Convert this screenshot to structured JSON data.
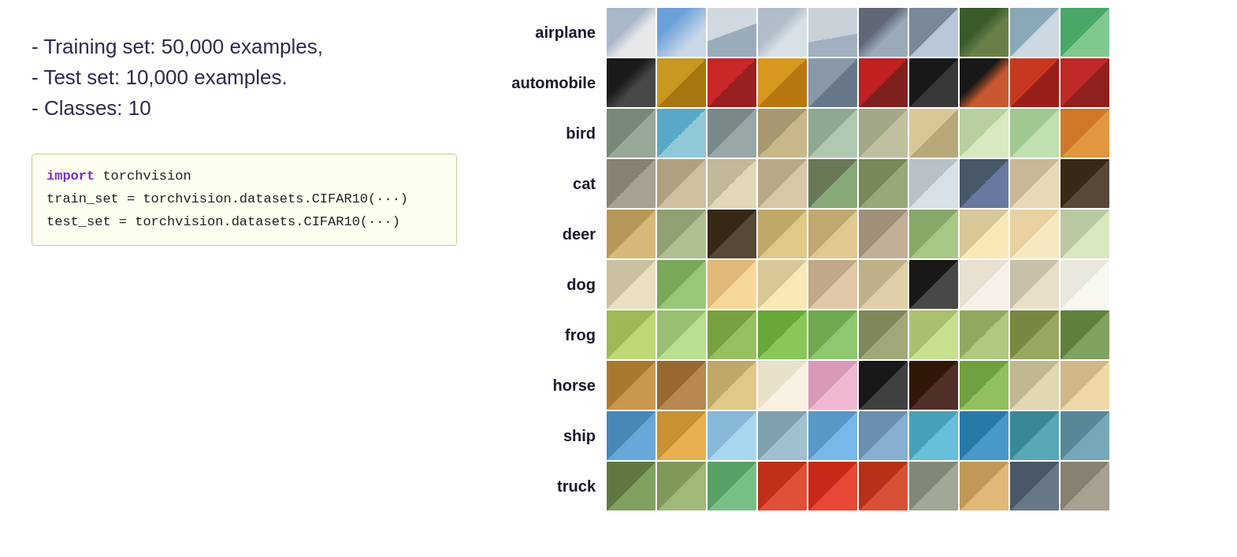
{
  "left": {
    "stats": [
      "- Training set: 50,000 examples,",
      "- Test set: 10,000 examples.",
      "- Classes: 10"
    ],
    "code": {
      "line1_keyword": "import",
      "line1_rest": " torchvision",
      "line2": "train_set = torchvision.datasets.CIFAR10(···)",
      "line3": "test_set  = torchvision.datasets.CIFAR10(···)"
    }
  },
  "right": {
    "classes": [
      "airplane",
      "automobile",
      "bird",
      "cat",
      "deer",
      "dog",
      "frog",
      "horse",
      "ship",
      "truck"
    ]
  }
}
